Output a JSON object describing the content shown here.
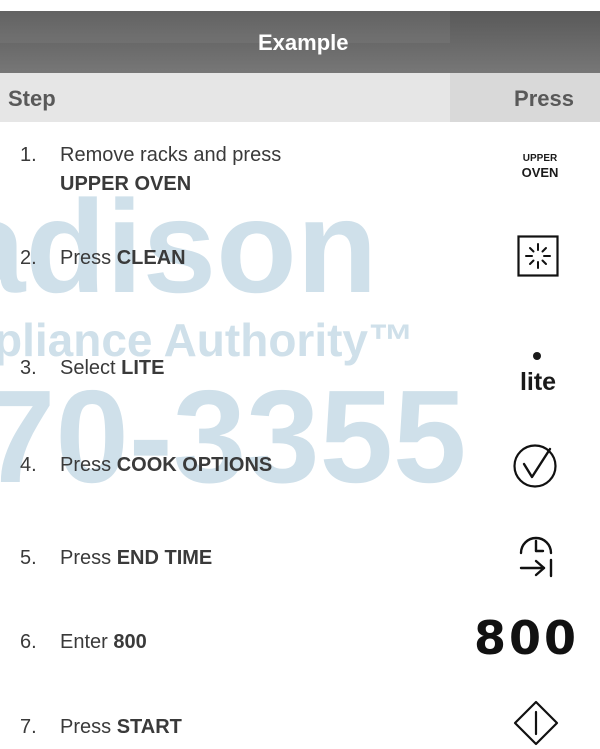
{
  "title": "Example",
  "headers": {
    "step": "Step",
    "press": "Press"
  },
  "watermark": {
    "line1": "adison",
    "line2": "pliance Authority™",
    "line3": "70-3355"
  },
  "steps": [
    {
      "num": "1.",
      "text": "Remove racks and press ",
      "bold": "UPPER OVEN",
      "icon": "upper-oven-key"
    },
    {
      "num": "2.",
      "text": "Press ",
      "bold": "CLEAN",
      "icon": "clean-sparkle-icon"
    },
    {
      "num": "3.",
      "text": "Select ",
      "bold": "LITE",
      "icon": "lite-key"
    },
    {
      "num": "4.",
      "text": "Press ",
      "bold": "COOK OPTIONS",
      "icon": "check-circle-icon"
    },
    {
      "num": "5.",
      "text": "Press ",
      "bold": "END TIME",
      "icon": "end-time-clock-icon"
    },
    {
      "num": "6.",
      "text": "Enter ",
      "bold": "800",
      "icon": "digits"
    },
    {
      "num": "7.",
      "text": "Press ",
      "bold": "START",
      "icon": "start-diamond-icon"
    }
  ],
  "keys": {
    "upper_oven_line1": "UPPER",
    "upper_oven_line2": "OVEN",
    "lite": "lite",
    "digits": "800"
  },
  "colors": {
    "title_bar": "#666666",
    "header_bg": "#e6e6e6",
    "watermark": "#cfe0ea"
  }
}
